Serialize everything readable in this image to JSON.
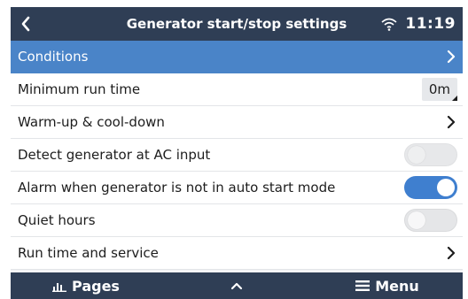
{
  "header": {
    "title": "Generator start/stop settings",
    "time": "11:19",
    "back_icon": "chevron-left-icon",
    "wifi_icon": "wifi-icon"
  },
  "rows": [
    {
      "label": "Conditions",
      "type": "submenu",
      "selected": true
    },
    {
      "label": "Minimum run time",
      "type": "value",
      "value": "0m"
    },
    {
      "label": "Warm-up & cool-down",
      "type": "submenu"
    },
    {
      "label": "Detect generator at AC input",
      "type": "switch",
      "state": "off",
      "enabled": false
    },
    {
      "label": "Alarm when generator is not in auto start mode",
      "type": "switch",
      "state": "on"
    },
    {
      "label": "Quiet hours",
      "type": "switch",
      "state": "off"
    },
    {
      "label": "Run time and service",
      "type": "submenu"
    }
  ],
  "footer": {
    "pages_label": "Pages",
    "menu_label": "Menu",
    "pages_icon": "bar-chart-icon",
    "up_icon": "chevron-up-icon",
    "menu_icon": "hamburger-menu-icon"
  },
  "colors": {
    "header_bg": "#2f3e55",
    "selected_row": "#4a84c8",
    "switch_on": "#3f7fcf"
  }
}
